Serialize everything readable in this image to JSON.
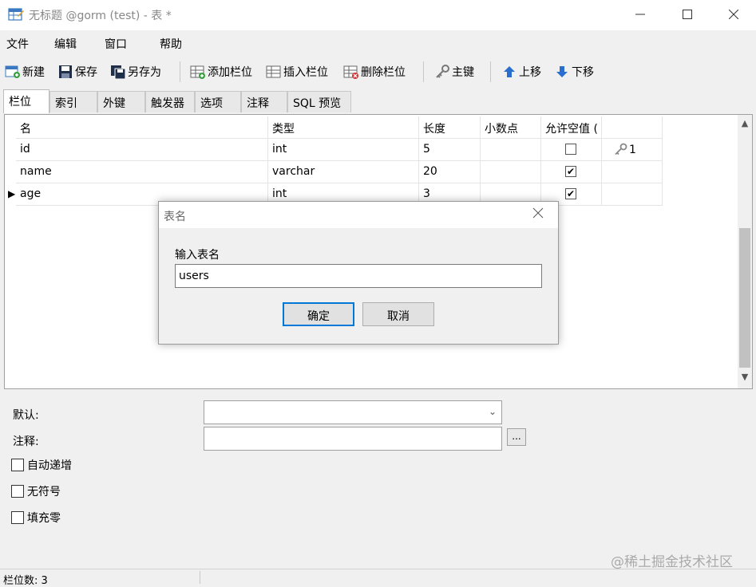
{
  "window": {
    "title": "无标题 @gorm (test) - 表 *"
  },
  "menu": {
    "items": [
      "文件",
      "编辑",
      "窗口",
      "帮助"
    ]
  },
  "toolbar": {
    "new": "新建",
    "save": "保存",
    "save_as": "另存为",
    "add_field": "添加栏位",
    "insert_field": "插入栏位",
    "delete_field": "删除栏位",
    "primary_key": "主键",
    "move_up": "上移",
    "move_down": "下移"
  },
  "tabs": [
    "栏位",
    "索引",
    "外键",
    "触发器",
    "选项",
    "注释",
    "SQL 预览"
  ],
  "grid": {
    "columns": [
      "名",
      "类型",
      "长度",
      "小数点",
      "允许空值 ("
    ],
    "rows": [
      {
        "name": "id",
        "type": "int",
        "length": "5",
        "decimals": "",
        "nullable": false,
        "key": "1"
      },
      {
        "name": "name",
        "type": "varchar",
        "length": "20",
        "decimals": "",
        "nullable": true,
        "key": ""
      },
      {
        "name": "age",
        "type": "int",
        "length": "3",
        "decimals": "",
        "nullable": true,
        "key": ""
      }
    ],
    "current_row": 2
  },
  "dialog": {
    "title": "表名",
    "label": "输入表名",
    "value": "users",
    "ok": "确定",
    "cancel": "取消"
  },
  "props": {
    "default_label": "默认:",
    "comment_label": "注释:",
    "ellipsis": "...",
    "auto_increment": "自动递增",
    "unsigned": "无符号",
    "zerofill": "填充零"
  },
  "watermark": "@稀土掘金技术社区",
  "status": {
    "text": "栏位数: 3"
  }
}
